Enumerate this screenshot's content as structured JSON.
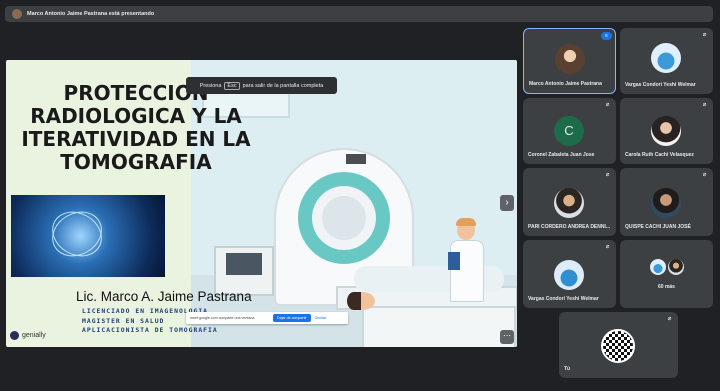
{
  "topbar": {
    "presenter_text": "Marco Antonio Jaime Pastrana está presentando"
  },
  "presentation": {
    "title_lines": [
      "PROTECCION",
      "RADIOLOGICA Y LA",
      "ITERATIVIDAD EN LA",
      "TOMOGRAFIA"
    ],
    "author": "Lic. Marco A. Jaime Pastrana",
    "lines": [
      "LICENCIADO EN IMAGENOLOGIA",
      "MAGISTER EN SALUD",
      "APLICACIONISTA DE TOMOGRAFIA"
    ],
    "brand": "genially",
    "esc_hint": {
      "before": "Presiona",
      "key": "Esc",
      "after": "para salir de la pantalla completa"
    },
    "share_bar": {
      "text": "meet.google.com comparte una ventana",
      "stop_label": "Dejar de compartir",
      "hide_label": "Ocultar"
    },
    "next_icon": "›",
    "more_icon": "⋯"
  },
  "participants": [
    {
      "name": "Marco Antonio Jaime Pastrana",
      "avatar": "photo",
      "speaking": true
    },
    {
      "name": "Vargas Condori Yeshi Welmar",
      "avatar": "photo"
    },
    {
      "name": "Coronel Zabaleta Juan Jose",
      "avatar": "letter",
      "letter": "C"
    },
    {
      "name": "Carola Ruth Cachi Velasquez",
      "avatar": "photo"
    },
    {
      "name": "PARI CORDERO ANDREA DENNI...",
      "avatar": "photo"
    },
    {
      "name": "QUISPE CACHI JUAN JOSÉ",
      "avatar": "photo"
    },
    {
      "name": "Vargas Condori Yeshi Welmar",
      "avatar": "photo"
    },
    {
      "name": "60 más",
      "avatar": "group"
    },
    {
      "name": "Tú",
      "avatar": "qr"
    }
  ],
  "colors": {
    "background": "#202124",
    "tile": "#3c4043",
    "accent": "#8ab4f8",
    "share_button": "#1a73e8"
  }
}
